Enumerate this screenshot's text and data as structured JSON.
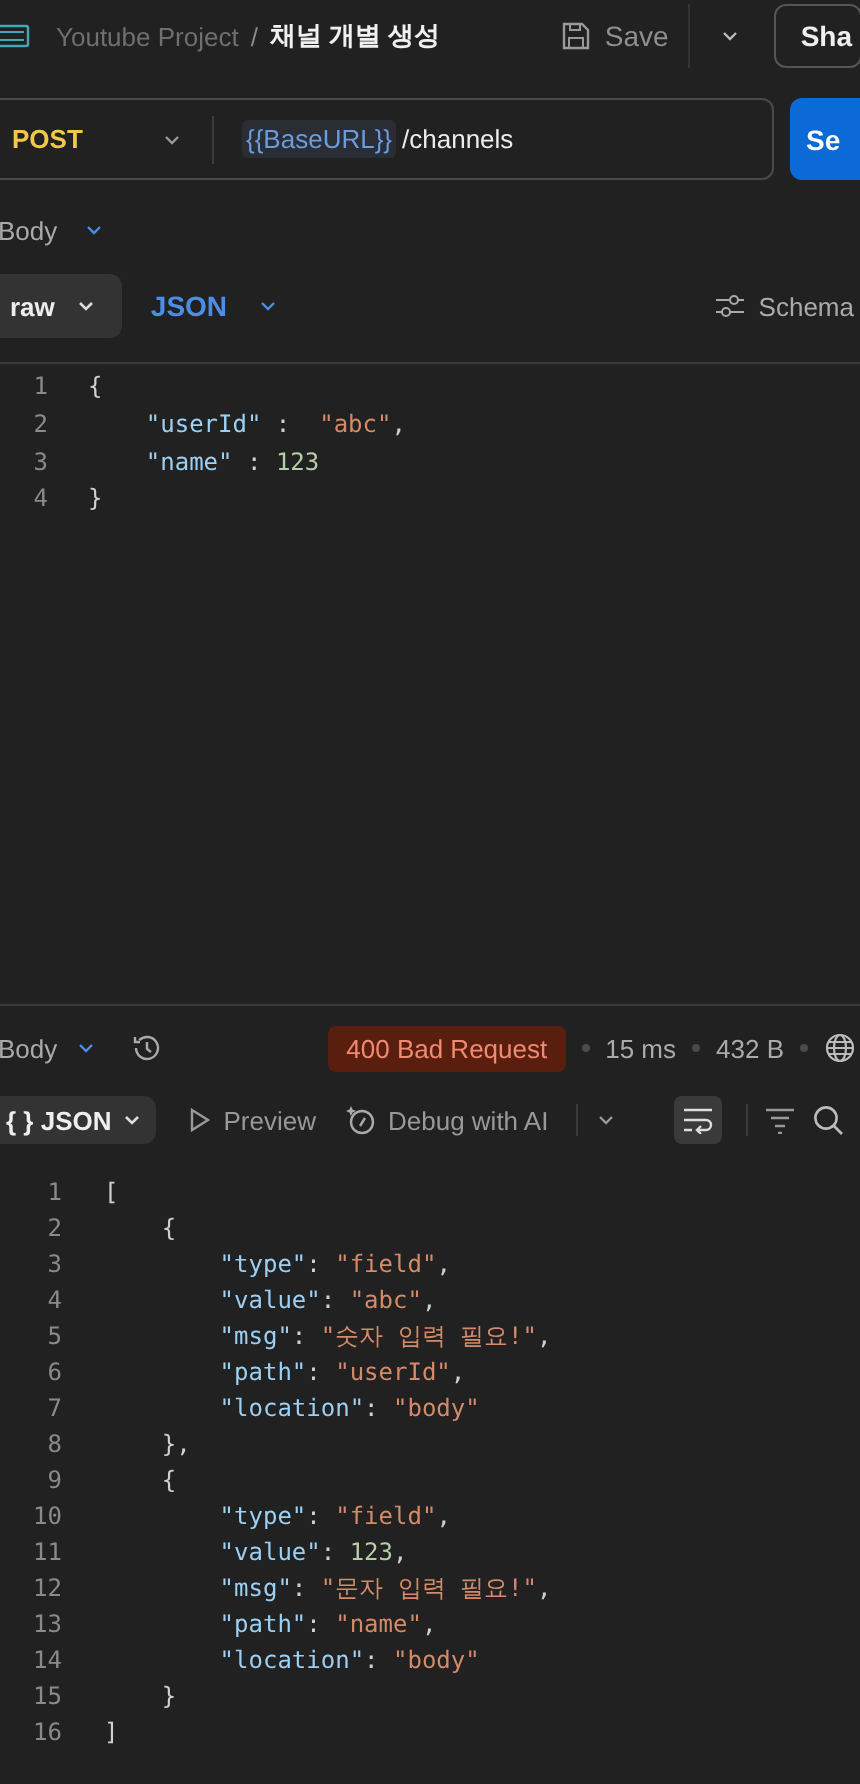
{
  "header": {
    "project": "Youtube Project",
    "separator": "/",
    "request_name": "채널 개별 생성",
    "save": "Save",
    "share": "Sha"
  },
  "request": {
    "method": "POST",
    "variable": "{{BaseURL}}",
    "path": "/channels",
    "send": "Se"
  },
  "body_section": {
    "label": "Body"
  },
  "body_tabs": {
    "mode": "raw",
    "format": "JSON",
    "schema": "Schema"
  },
  "request_body": [
    {
      "number": "1",
      "tokens": [
        {
          "kind": "punct",
          "text": "{"
        }
      ]
    },
    {
      "number": "2",
      "tokens": [
        {
          "kind": "key",
          "text": "    \"userId\""
        },
        {
          "kind": "punct",
          "text": " :  "
        },
        {
          "kind": "string",
          "text": "\"abc\""
        },
        {
          "kind": "punct",
          "text": ","
        }
      ]
    },
    {
      "number": "3",
      "tokens": [
        {
          "kind": "key",
          "text": "    \"name\""
        },
        {
          "kind": "punct",
          "text": " : "
        },
        {
          "kind": "number",
          "text": "123"
        }
      ]
    },
    {
      "number": "4",
      "tokens": [
        {
          "kind": "punct",
          "text": "}"
        }
      ]
    }
  ],
  "response": {
    "label": "Body",
    "status": "400 Bad Request",
    "time": "15 ms",
    "size": "432 B"
  },
  "response_toolbar": {
    "format": "{ } JSON",
    "preview": "Preview",
    "debug": "Debug with AI"
  },
  "response_body": [
    {
      "number": "1",
      "tokens": [
        {
          "kind": "punct",
          "text": "["
        }
      ]
    },
    {
      "number": "2",
      "tokens": [
        {
          "kind": "punct",
          "text": "    {"
        }
      ]
    },
    {
      "number": "3",
      "tokens": [
        {
          "kind": "key",
          "text": "        \"type\""
        },
        {
          "kind": "punct",
          "text": ": "
        },
        {
          "kind": "string",
          "text": "\"field\""
        },
        {
          "kind": "punct",
          "text": ","
        }
      ]
    },
    {
      "number": "4",
      "tokens": [
        {
          "kind": "key",
          "text": "        \"value\""
        },
        {
          "kind": "punct",
          "text": ": "
        },
        {
          "kind": "string",
          "text": "\"abc\""
        },
        {
          "kind": "punct",
          "text": ","
        }
      ]
    },
    {
      "number": "5",
      "tokens": [
        {
          "kind": "key",
          "text": "        \"msg\""
        },
        {
          "kind": "punct",
          "text": ": "
        },
        {
          "kind": "string",
          "text": "\"숫자 입력 필요!\""
        },
        {
          "kind": "punct",
          "text": ","
        }
      ]
    },
    {
      "number": "6",
      "tokens": [
        {
          "kind": "key",
          "text": "        \"path\""
        },
        {
          "kind": "punct",
          "text": ": "
        },
        {
          "kind": "string",
          "text": "\"userId\""
        },
        {
          "kind": "punct",
          "text": ","
        }
      ]
    },
    {
      "number": "7",
      "tokens": [
        {
          "kind": "key",
          "text": "        \"location\""
        },
        {
          "kind": "punct",
          "text": ": "
        },
        {
          "kind": "string",
          "text": "\"body\""
        }
      ]
    },
    {
      "number": "8",
      "tokens": [
        {
          "kind": "punct",
          "text": "    },"
        }
      ]
    },
    {
      "number": "9",
      "tokens": [
        {
          "kind": "punct",
          "text": "    {"
        }
      ]
    },
    {
      "number": "10",
      "tokens": [
        {
          "kind": "key",
          "text": "        \"type\""
        },
        {
          "kind": "punct",
          "text": ": "
        },
        {
          "kind": "string",
          "text": "\"field\""
        },
        {
          "kind": "punct",
          "text": ","
        }
      ]
    },
    {
      "number": "11",
      "tokens": [
        {
          "kind": "key",
          "text": "        \"value\""
        },
        {
          "kind": "punct",
          "text": ": "
        },
        {
          "kind": "number",
          "text": "123"
        },
        {
          "kind": "punct",
          "text": ","
        }
      ]
    },
    {
      "number": "12",
      "tokens": [
        {
          "kind": "key",
          "text": "        \"msg\""
        },
        {
          "kind": "punct",
          "text": ": "
        },
        {
          "kind": "string",
          "text": "\"문자 입력 필요!\""
        },
        {
          "kind": "punct",
          "text": ","
        }
      ]
    },
    {
      "number": "13",
      "tokens": [
        {
          "kind": "key",
          "text": "        \"path\""
        },
        {
          "kind": "punct",
          "text": ": "
        },
        {
          "kind": "string",
          "text": "\"name\""
        },
        {
          "kind": "punct",
          "text": ","
        }
      ]
    },
    {
      "number": "14",
      "tokens": [
        {
          "kind": "key",
          "text": "        \"location\""
        },
        {
          "kind": "punct",
          "text": ": "
        },
        {
          "kind": "string",
          "text": "\"body\""
        }
      ]
    },
    {
      "number": "15",
      "tokens": [
        {
          "kind": "punct",
          "text": "    }"
        }
      ]
    },
    {
      "number": "16",
      "tokens": [
        {
          "kind": "punct",
          "text": "]"
        }
      ]
    }
  ]
}
